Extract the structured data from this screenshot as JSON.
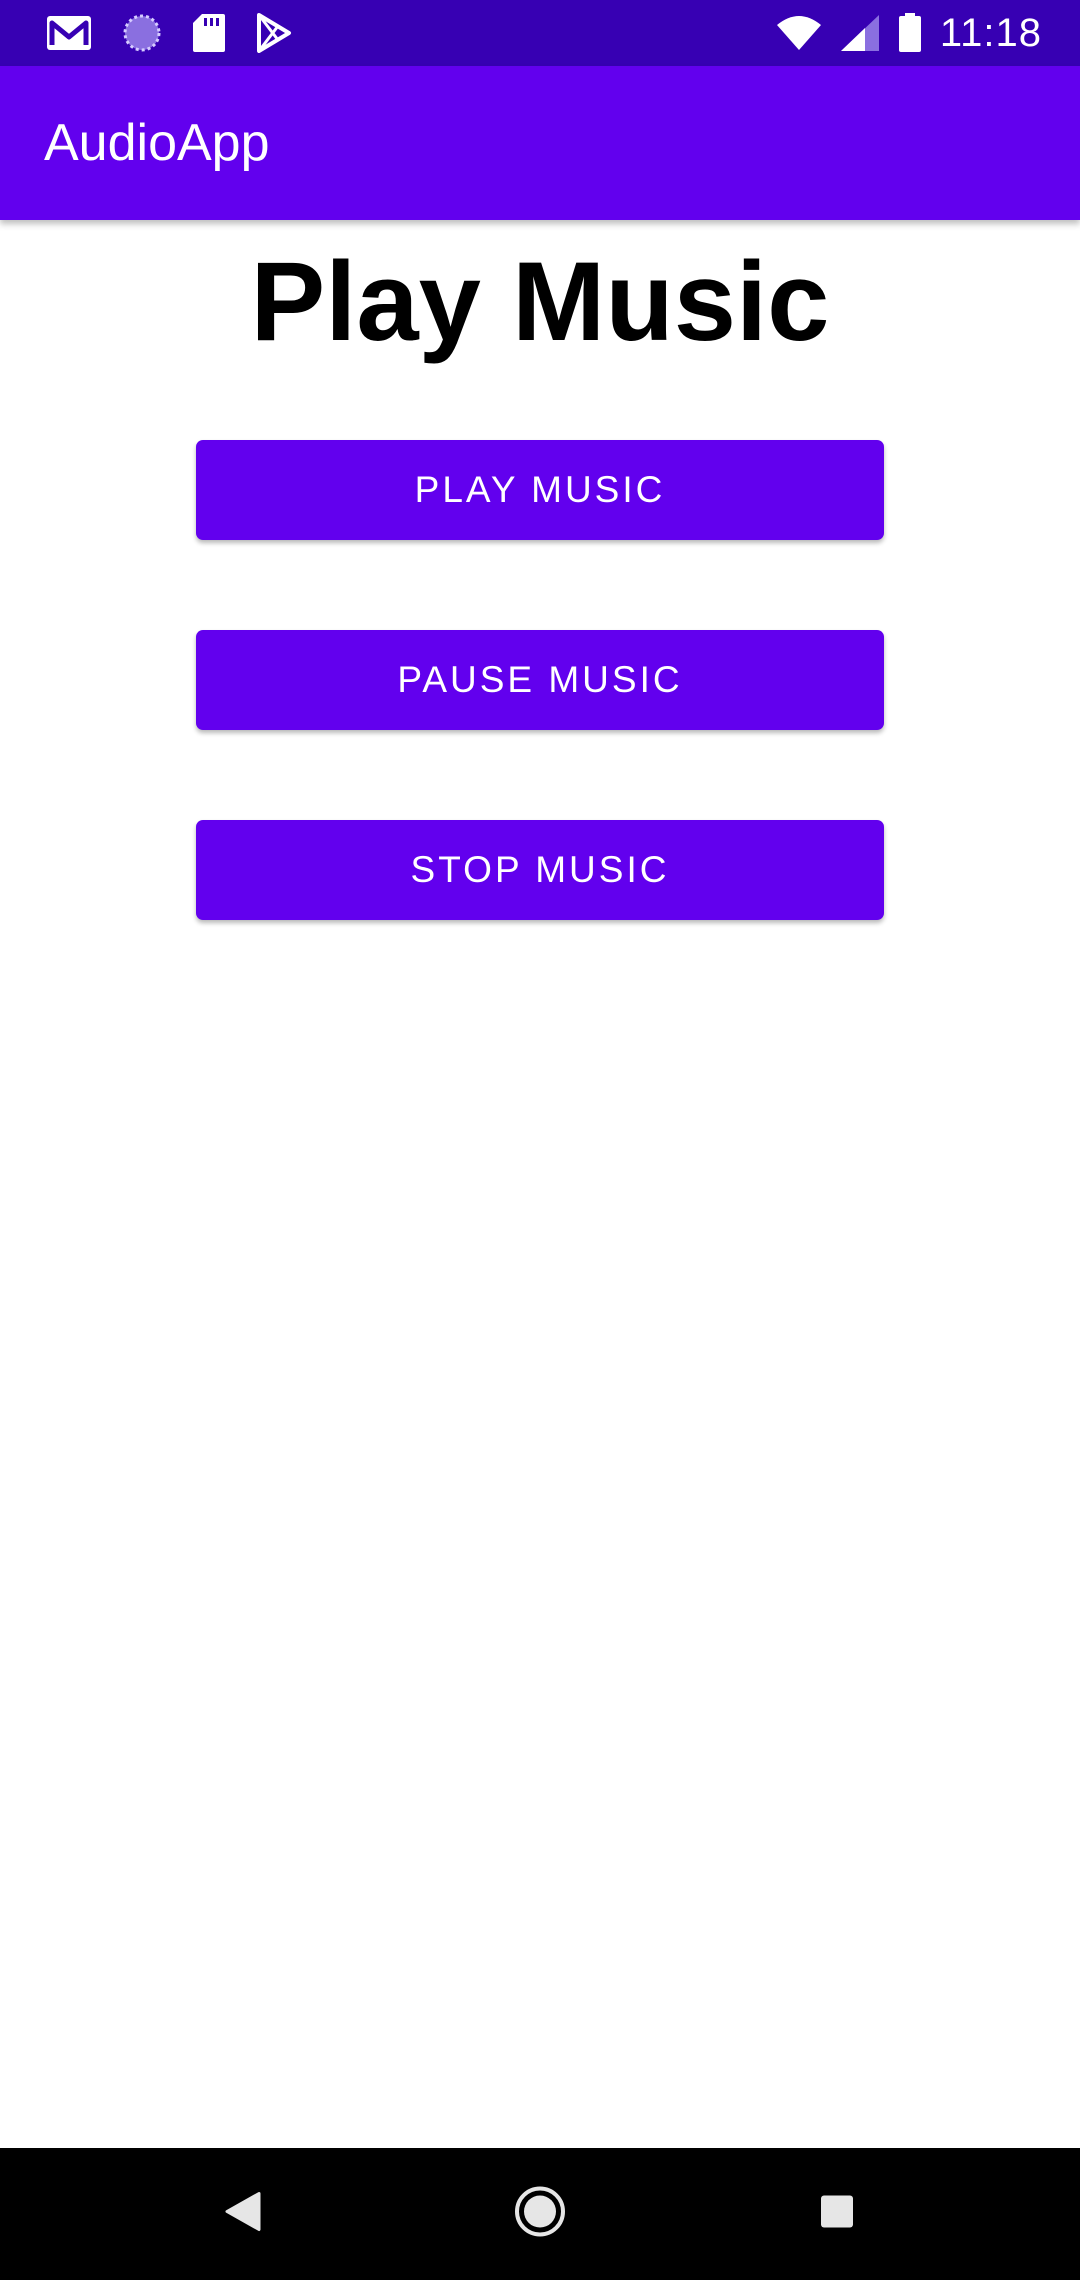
{
  "status_bar": {
    "time": "11:18",
    "left_icons": [
      "gmail-icon",
      "loading-circle-icon",
      "sd-card-icon",
      "play-store-icon"
    ],
    "right_icons": [
      "wifi-icon",
      "cell-signal-icon",
      "battery-icon"
    ],
    "background": "#3700b3"
  },
  "app_bar": {
    "title": "AudioApp",
    "background": "#6200ee"
  },
  "main": {
    "heading": "Play Music",
    "buttons": {
      "play": "PLAY MUSIC",
      "pause": "PAUSE MUSIC",
      "stop": "STOP MUSIC"
    },
    "button_color": "#6200ee"
  },
  "nav_bar": {
    "icons": [
      "back-icon",
      "home-icon",
      "recents-icon"
    ]
  }
}
